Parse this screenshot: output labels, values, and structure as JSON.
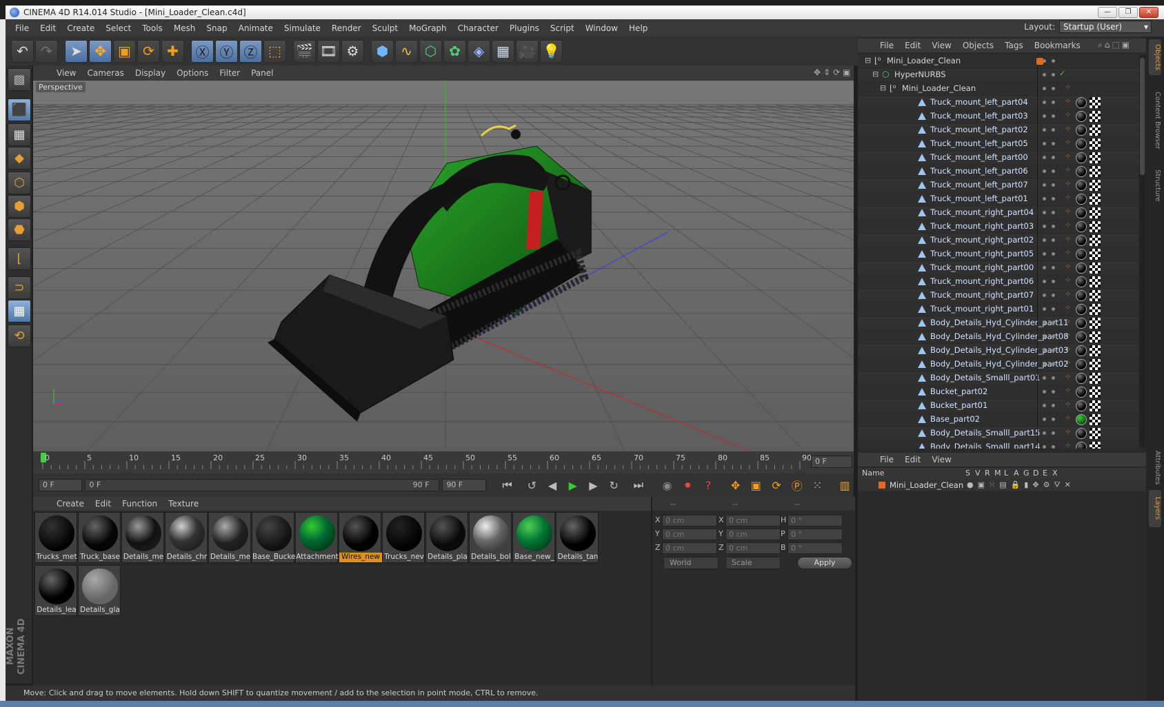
{
  "window": {
    "title": "CINEMA 4D R14.014 Studio - [Mini_Loader_Clean.c4d]",
    "min": "—",
    "max": "❐",
    "close": "✕"
  },
  "menu": [
    "File",
    "Edit",
    "Create",
    "Select",
    "Tools",
    "Mesh",
    "Snap",
    "Animate",
    "Simulate",
    "Render",
    "Sculpt",
    "MoGraph",
    "Character",
    "Plugins",
    "Script",
    "Window",
    "Help"
  ],
  "layout": {
    "label": "Layout:",
    "value": "Startup (User)"
  },
  "viewport": {
    "menu": [
      "View",
      "Cameras",
      "Display",
      "Options",
      "Filter",
      "Panel"
    ],
    "camera_label": "Perspective"
  },
  "timeline": {
    "ticks": [
      "0",
      "5",
      "10",
      "15",
      "20",
      "25",
      "30",
      "35",
      "40",
      "45",
      "50",
      "55",
      "60",
      "65",
      "70",
      "75",
      "80",
      "85",
      "90"
    ],
    "current_frame": "0 F",
    "start": "0 F",
    "range_start": "0 F",
    "range_end": "90 F",
    "end": "90 F"
  },
  "materials": {
    "menu": [
      "Create",
      "Edit",
      "Function",
      "Texture"
    ],
    "items": [
      {
        "name": "Trucks_met"
      },
      {
        "name": "Truck_base"
      },
      {
        "name": "Details_me"
      },
      {
        "name": "Details_chr"
      },
      {
        "name": "Details_me"
      },
      {
        "name": "Base_Bucke"
      },
      {
        "name": "Attachment"
      },
      {
        "name": "Wires_new"
      },
      {
        "name": "Trucks_nev"
      },
      {
        "name": "Details_pla"
      },
      {
        "name": "Details_bol"
      },
      {
        "name": "Base_new_"
      },
      {
        "name": "Details_tan"
      },
      {
        "name": "Details_lea"
      },
      {
        "name": "Details_gla"
      }
    ],
    "selected_index": 7
  },
  "coordinates": {
    "headers": [
      "--",
      "--",
      "--"
    ],
    "rows": [
      {
        "a": "X",
        "av": "0 cm",
        "b": "X",
        "bv": "0 cm",
        "c": "H",
        "cv": "0 °"
      },
      {
        "a": "Y",
        "av": "0 cm",
        "b": "Y",
        "bv": "0 cm",
        "c": "P",
        "cv": "0 °"
      },
      {
        "a": "Z",
        "av": "0 cm",
        "b": "Z",
        "bv": "0 cm",
        "c": "B",
        "cv": "0 °"
      }
    ],
    "mode": "World",
    "type": "Scale",
    "apply": "Apply"
  },
  "status": "Move: Click and drag to move elements. Hold down SHIFT to quantize movement / add to the selection in point mode, CTRL to remove.",
  "objects": {
    "menu": [
      "File",
      "Edit",
      "View",
      "Objects",
      "Tags",
      "Bookmarks"
    ],
    "items": [
      {
        "name": "Mini_Loader_Clean",
        "indent": 0,
        "kind": "null"
      },
      {
        "name": "HyperNURBS",
        "indent": 1,
        "kind": "nurbs"
      },
      {
        "name": "Mini_Loader_Clean",
        "indent": 2,
        "kind": "null"
      },
      {
        "name": "Truck_mount_left_part04",
        "indent": 3,
        "kind": "mesh"
      },
      {
        "name": "Truck_mount_left_part03",
        "indent": 3,
        "kind": "mesh"
      },
      {
        "name": "Truck_mount_left_part02",
        "indent": 3,
        "kind": "mesh"
      },
      {
        "name": "Truck_mount_left_part05",
        "indent": 3,
        "kind": "mesh"
      },
      {
        "name": "Truck_mount_left_part00",
        "indent": 3,
        "kind": "mesh"
      },
      {
        "name": "Truck_mount_left_part06",
        "indent": 3,
        "kind": "mesh"
      },
      {
        "name": "Truck_mount_left_part07",
        "indent": 3,
        "kind": "mesh"
      },
      {
        "name": "Truck_mount_left_part01",
        "indent": 3,
        "kind": "mesh"
      },
      {
        "name": "Truck_mount_right_part04",
        "indent": 3,
        "kind": "mesh"
      },
      {
        "name": "Truck_mount_right_part03",
        "indent": 3,
        "kind": "mesh"
      },
      {
        "name": "Truck_mount_right_part02",
        "indent": 3,
        "kind": "mesh"
      },
      {
        "name": "Truck_mount_right_part05",
        "indent": 3,
        "kind": "mesh"
      },
      {
        "name": "Truck_mount_right_part00",
        "indent": 3,
        "kind": "mesh"
      },
      {
        "name": "Truck_mount_right_part06",
        "indent": 3,
        "kind": "mesh"
      },
      {
        "name": "Truck_mount_right_part07",
        "indent": 3,
        "kind": "mesh"
      },
      {
        "name": "Truck_mount_right_part01",
        "indent": 3,
        "kind": "mesh"
      },
      {
        "name": "Body_Details_Hyd_Cylinder_part11",
        "indent": 3,
        "kind": "mesh"
      },
      {
        "name": "Body_Details_Hyd_Cylinder_part08",
        "indent": 3,
        "kind": "mesh"
      },
      {
        "name": "Body_Details_Hyd_Cylinder_part03",
        "indent": 3,
        "kind": "mesh"
      },
      {
        "name": "Body_Details_Hyd_Cylinder_part02",
        "indent": 3,
        "kind": "mesh"
      },
      {
        "name": "Body_Details_Smalll_part01",
        "indent": 3,
        "kind": "mesh"
      },
      {
        "name": "Bucket_part02",
        "indent": 3,
        "kind": "mesh"
      },
      {
        "name": "Bucket_part01",
        "indent": 3,
        "kind": "mesh"
      },
      {
        "name": "Base_part02",
        "indent": 3,
        "kind": "mesh"
      },
      {
        "name": "Body_Details_Smalll_part15",
        "indent": 3,
        "kind": "mesh"
      },
      {
        "name": "Body_Details_Smalll_part14",
        "indent": 3,
        "kind": "mesh"
      }
    ]
  },
  "layers": {
    "menu": [
      "File",
      "Edit",
      "View"
    ],
    "columns": [
      "Name",
      "S",
      "V",
      "R",
      "M",
      "L",
      "A",
      "G",
      "D",
      "E",
      "X"
    ],
    "items": [
      {
        "name": "Mini_Loader_Clean"
      }
    ]
  },
  "side_tabs": [
    "Objects",
    "Content Browser",
    "Structure",
    "Attributes",
    "Layers"
  ],
  "colors": {
    "accent": "#e0901c",
    "selection_blue": "#5b7fae",
    "loader_green": "#1d7a1d",
    "background": "#2b2b2b"
  }
}
